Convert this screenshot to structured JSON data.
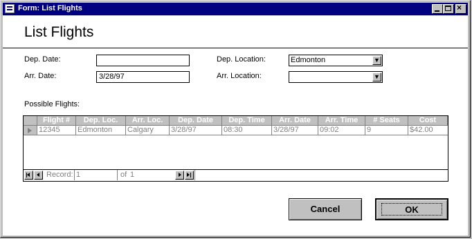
{
  "window": {
    "title": "Form: List Flights"
  },
  "form": {
    "heading": "List Flights",
    "dep_date": {
      "label": "Dep. Date:",
      "value": ""
    },
    "arr_date": {
      "label": "Arr. Date:",
      "value": "3/28/97"
    },
    "dep_location": {
      "label": "Dep. Location:",
      "value": "Edmonton"
    },
    "arr_location": {
      "label": "Arr. Location:",
      "value": ""
    },
    "possible_label": "Possible Flights:"
  },
  "grid": {
    "columns": [
      "Flight #",
      "Dep. Loc.",
      "Arr. Loc.",
      "Dep. Date",
      "Dep. Time",
      "Arr. Date",
      "Arr. Time",
      "# Seats",
      "Cost"
    ],
    "rows": [
      [
        "12345",
        "Edmonton",
        "Calgary",
        "3/28/97",
        "08:30",
        "3/28/97",
        "09:02",
        "9",
        "$42.00"
      ]
    ],
    "nav": {
      "record_label": "Record:",
      "record_value": "1",
      "of_label": "of",
      "of_value": "1"
    }
  },
  "buttons": {
    "cancel": "Cancel",
    "ok": "OK"
  },
  "colors": {
    "titlebar": "#000080",
    "face": "#c0c0c0"
  }
}
